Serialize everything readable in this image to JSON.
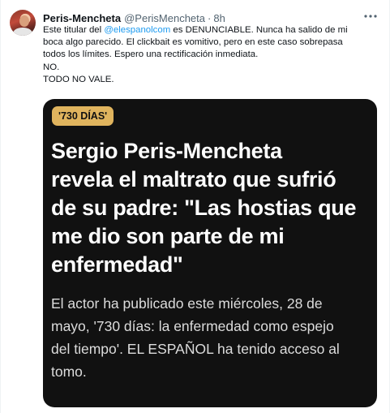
{
  "tweet": {
    "display_name": "Peris-Mencheta",
    "handle": "@PerisMencheta",
    "separator": "·",
    "time": "8h",
    "more_icon": "more-horizontal-icon",
    "text": {
      "l1_pre": "Este titular del ",
      "l1_mention": "@elespanolcom",
      "l1_post": " es DENUNCIABLE. Nunca ha salido de mi",
      "l2": "boca algo parecido. El clickbait es vomitivo, pero en este caso sobrepasa",
      "l3": "todos los límites. Espero una rectificación inmediata.",
      "l4": "NO.",
      "l5": "TODO NO VALE."
    }
  },
  "card": {
    "tag": "'730 DÍAS'",
    "headline": [
      "Sergio Peris-Mencheta",
      "revela el maltrato que sufrió",
      "de su padre: \"Las hostias que",
      "me dio son parte de mi",
      "enfermedad\""
    ],
    "subhead": [
      "El actor ha publicado este miércoles, 28 de",
      "mayo, '730 días: la enfermedad como espejo",
      "del tiempo'. EL ESPAÑOL ha tenido acceso al",
      "tomo."
    ],
    "colors": {
      "card_bg": "#111111",
      "tag_bg": "#e0b45e",
      "headline": "#ffffff",
      "subhead": "#dcdcdc"
    }
  },
  "colors": {
    "link": "#1d9bf0",
    "secondary": "#536471",
    "text": "#0f1419"
  }
}
